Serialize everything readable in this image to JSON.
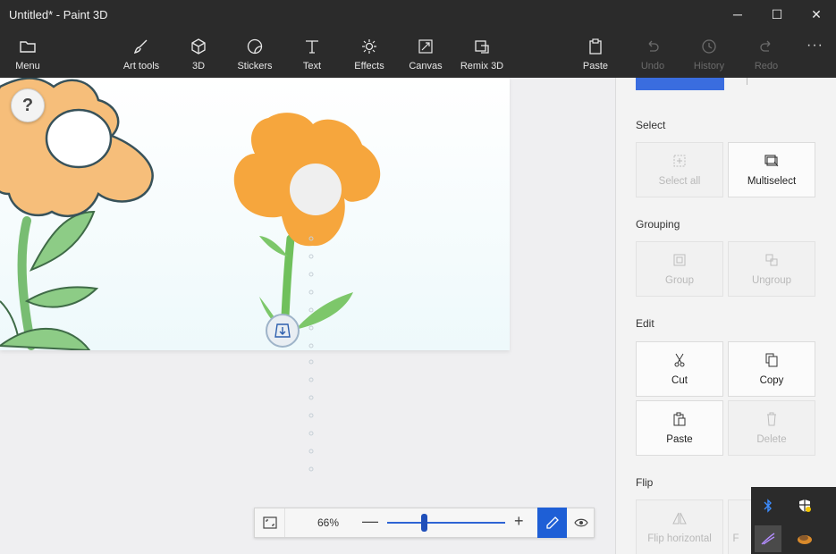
{
  "window": {
    "title": "Untitled* - Paint 3D",
    "minimize": "─",
    "maximize": "☐",
    "close": "✕"
  },
  "toolbar": {
    "menu": "Menu",
    "art_tools": "Art tools",
    "three_d": "3D",
    "stickers": "Stickers",
    "text": "Text",
    "effects": "Effects",
    "canvas": "Canvas",
    "remix": "Remix 3D",
    "paste": "Paste",
    "undo": "Undo",
    "history": "History",
    "redo": "Redo",
    "more": "···"
  },
  "canvas": {
    "help": "?"
  },
  "zoom": {
    "percent": "66%",
    "minus": "—",
    "plus": "+",
    "level": 0.33
  },
  "panel": {
    "select_heading": "Select",
    "select_all": "Select all",
    "multiselect": "Multiselect",
    "grouping_heading": "Grouping",
    "group": "Group",
    "ungroup": "Ungroup",
    "edit_heading": "Edit",
    "cut": "Cut",
    "copy": "Copy",
    "paste": "Paste",
    "delete": "Delete",
    "flip_heading": "Flip",
    "flip_horizontal": "Flip horizontal",
    "flip_vertical_partial": "F"
  },
  "colors": {
    "accent": "#1e5fd6",
    "flower": "#f7a640",
    "stem": "#6cbf5b"
  }
}
